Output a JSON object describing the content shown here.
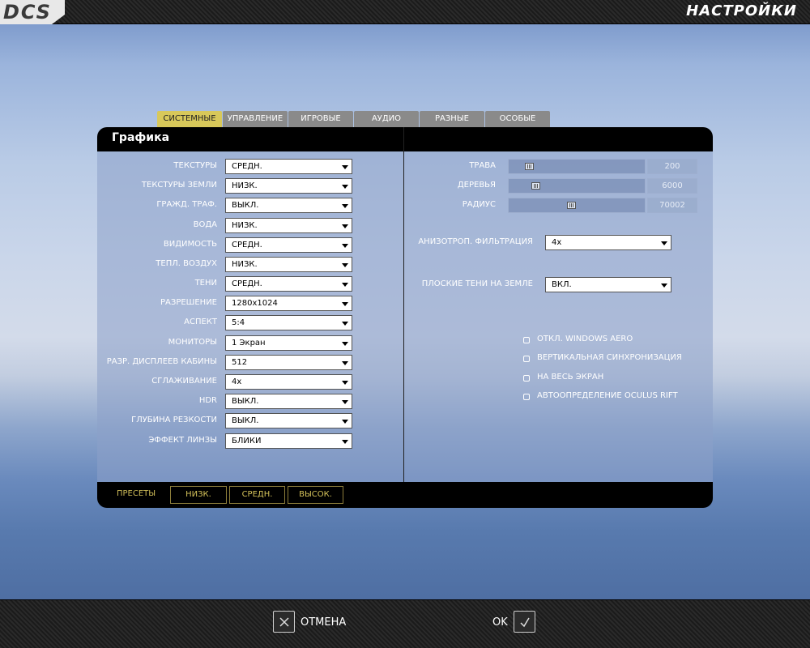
{
  "app": {
    "logo": "DCS",
    "title": "НАСТРОЙКИ"
  },
  "tabs": [
    {
      "label": "СИСТЕМНЫЕ",
      "active": true
    },
    {
      "label": "УПРАВЛЕНИЕ",
      "active": false
    },
    {
      "label": "ИГРОВЫЕ",
      "active": false
    },
    {
      "label": "АУДИО",
      "active": false
    },
    {
      "label": "РАЗНЫЕ",
      "active": false
    },
    {
      "label": "ОСОБЫЕ",
      "active": false
    }
  ],
  "panel": {
    "title": "Графика"
  },
  "left_settings": [
    {
      "label": "ТЕКСТУРЫ",
      "value": "СРЕДН."
    },
    {
      "label": "ТЕКСТУРЫ ЗЕМЛИ",
      "value": "НИЗК."
    },
    {
      "label": "ГРАЖД. ТРАФ.",
      "value": "ВЫКЛ."
    },
    {
      "label": "ВОДА",
      "value": "НИЗК."
    },
    {
      "label": "ВИДИМОСТЬ",
      "value": "СРЕДН."
    },
    {
      "label": "ТЕПЛ. ВОЗДУХ",
      "value": "НИЗК."
    },
    {
      "label": "ТЕНИ",
      "value": "СРЕДН."
    },
    {
      "label": "РАЗРЕШЕНИЕ",
      "value": "1280x1024"
    },
    {
      "label": "АСПЕКТ",
      "value": "5:4"
    },
    {
      "label": "МОНИТОРЫ",
      "value": "1 Экран"
    },
    {
      "label": "РАЗР. ДИСПЛЕЕВ КАБИНЫ",
      "value": "512"
    },
    {
      "label": "СГЛАЖИВАНИЕ",
      "value": "4x"
    },
    {
      "label": "HDR",
      "value": "ВЫКЛ."
    },
    {
      "label": "ГЛУБИНА РЕЗКОСТИ",
      "value": "ВЫКЛ."
    },
    {
      "label": "ЭФФЕКТ ЛИНЗЫ",
      "value": "БЛИКИ"
    }
  ],
  "sliders": [
    {
      "label": "ТРАВА",
      "value": "200",
      "level": 0.13
    },
    {
      "label": "ДЕРЕВЬЯ",
      "value": "6000",
      "level": 0.18
    },
    {
      "label": "РАДИУС",
      "value": "70002",
      "level": 0.46
    }
  ],
  "right_selects": [
    {
      "label": "АНИЗОТРОП. ФИЛЬТРАЦИЯ",
      "value": "4x"
    },
    {
      "label": "ПЛОСКИЕ ТЕНИ НА ЗЕМЛЕ",
      "value": "ВКЛ."
    }
  ],
  "checkboxes": [
    {
      "label": "ОТКЛ. WINDOWS AERO",
      "checked": false
    },
    {
      "label": "ВЕРТИКАЛЬНАЯ СИНХРОНИЗАЦИЯ",
      "checked": false
    },
    {
      "label": "НА ВЕСЬ ЭКРАН",
      "checked": false
    },
    {
      "label": "АВТООПРЕДЕЛЕНИЕ OCULUS RIFT",
      "checked": false
    }
  ],
  "presets": {
    "label": "ПРЕСЕТЫ",
    "buttons": [
      "НИЗК.",
      "СРЕДН.",
      "ВЫСОК."
    ]
  },
  "bottom": {
    "cancel_label": "ОТМЕНА",
    "ok_label": "OK"
  }
}
